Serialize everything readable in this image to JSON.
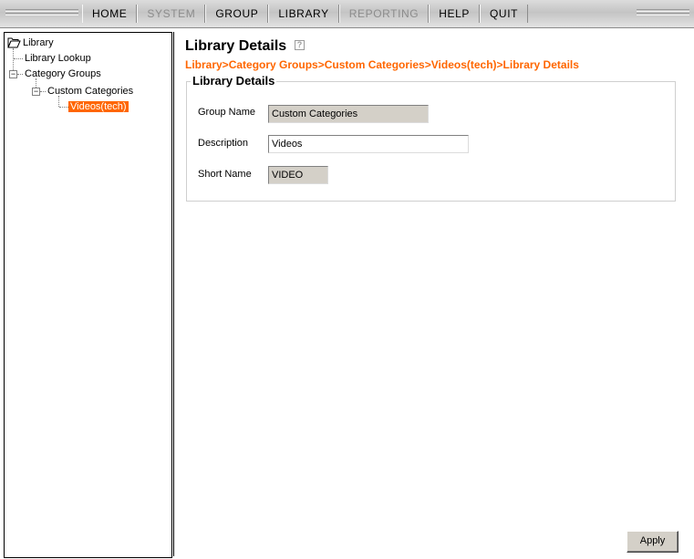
{
  "menu": {
    "items": [
      {
        "label": "HOME",
        "enabled": true
      },
      {
        "label": "SYSTEM",
        "enabled": false
      },
      {
        "label": "GROUP",
        "enabled": true
      },
      {
        "label": "LIBRARY",
        "enabled": true
      },
      {
        "label": "REPORTING",
        "enabled": false
      },
      {
        "label": "HELP",
        "enabled": true
      },
      {
        "label": "QUIT",
        "enabled": true
      }
    ]
  },
  "tree": {
    "root": {
      "label": "Library",
      "icon": "folder-icon"
    },
    "items": [
      {
        "label": "Library Lookup"
      },
      {
        "label": "Category Groups",
        "expanded": true
      },
      {
        "label": "Custom Categories",
        "expanded": true
      },
      {
        "label": "Videos(tech)",
        "selected": true
      }
    ]
  },
  "content": {
    "title": "Library Details",
    "help_icon": "?",
    "breadcrumb": "Library>Category Groups>Custom Categories>Videos(tech)>Library Details",
    "fieldset_legend": "Library Details",
    "fields": {
      "group_name": {
        "label": "Group Name",
        "value": "Custom Categories",
        "readonly": true
      },
      "description": {
        "label": "Description",
        "value": "Videos",
        "readonly": false
      },
      "short_name": {
        "label": "Short Name",
        "value": "VIDEO",
        "readonly": true
      }
    },
    "apply_label": "Apply"
  },
  "colors": {
    "accent": "#ff6600",
    "readonly_field": "#d4d0c8",
    "disabled_text": "#8c8c8c"
  }
}
